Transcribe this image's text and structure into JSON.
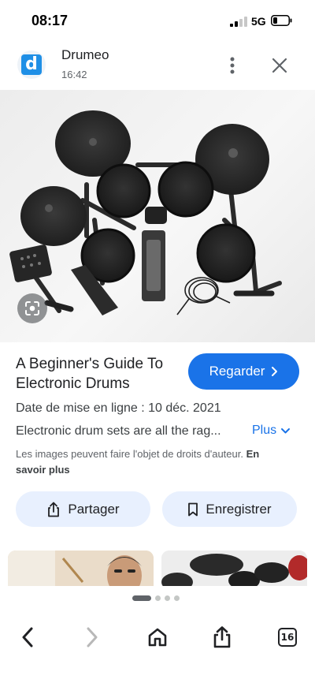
{
  "status_bar": {
    "time": "08:17",
    "network": "5G"
  },
  "source": {
    "logo_letter": "d",
    "name": "Drumeo",
    "time": "16:42"
  },
  "result": {
    "title": "A Beginner's Guide To Electronic Drums",
    "watch_label": "Regarder",
    "published": "Date de mise en ligne : 10 déc. 2021",
    "description": "Electronic drum sets are all the rag...",
    "more_label": "Plus",
    "copyright_text": "Les images peuvent faire l'objet de droits d'auteur.",
    "learn_more": "En savoir plus",
    "share_label": "Partager",
    "save_label": "Enregistrer"
  },
  "pager": {
    "count": 4,
    "active": 0
  },
  "bottom_bar": {
    "tabs_count": "16"
  },
  "colors": {
    "accent": "#1a73e8",
    "chip_bg": "#e8f0fe",
    "logo": "#1f8fe6"
  },
  "icons": [
    "signal-icon",
    "battery-icon",
    "more-vert-icon",
    "close-icon",
    "lens-icon",
    "chevron-right-icon",
    "chevron-down-icon",
    "share-icon",
    "bookmark-icon",
    "back-icon",
    "forward-icon",
    "home-icon",
    "tabs-icon"
  ]
}
